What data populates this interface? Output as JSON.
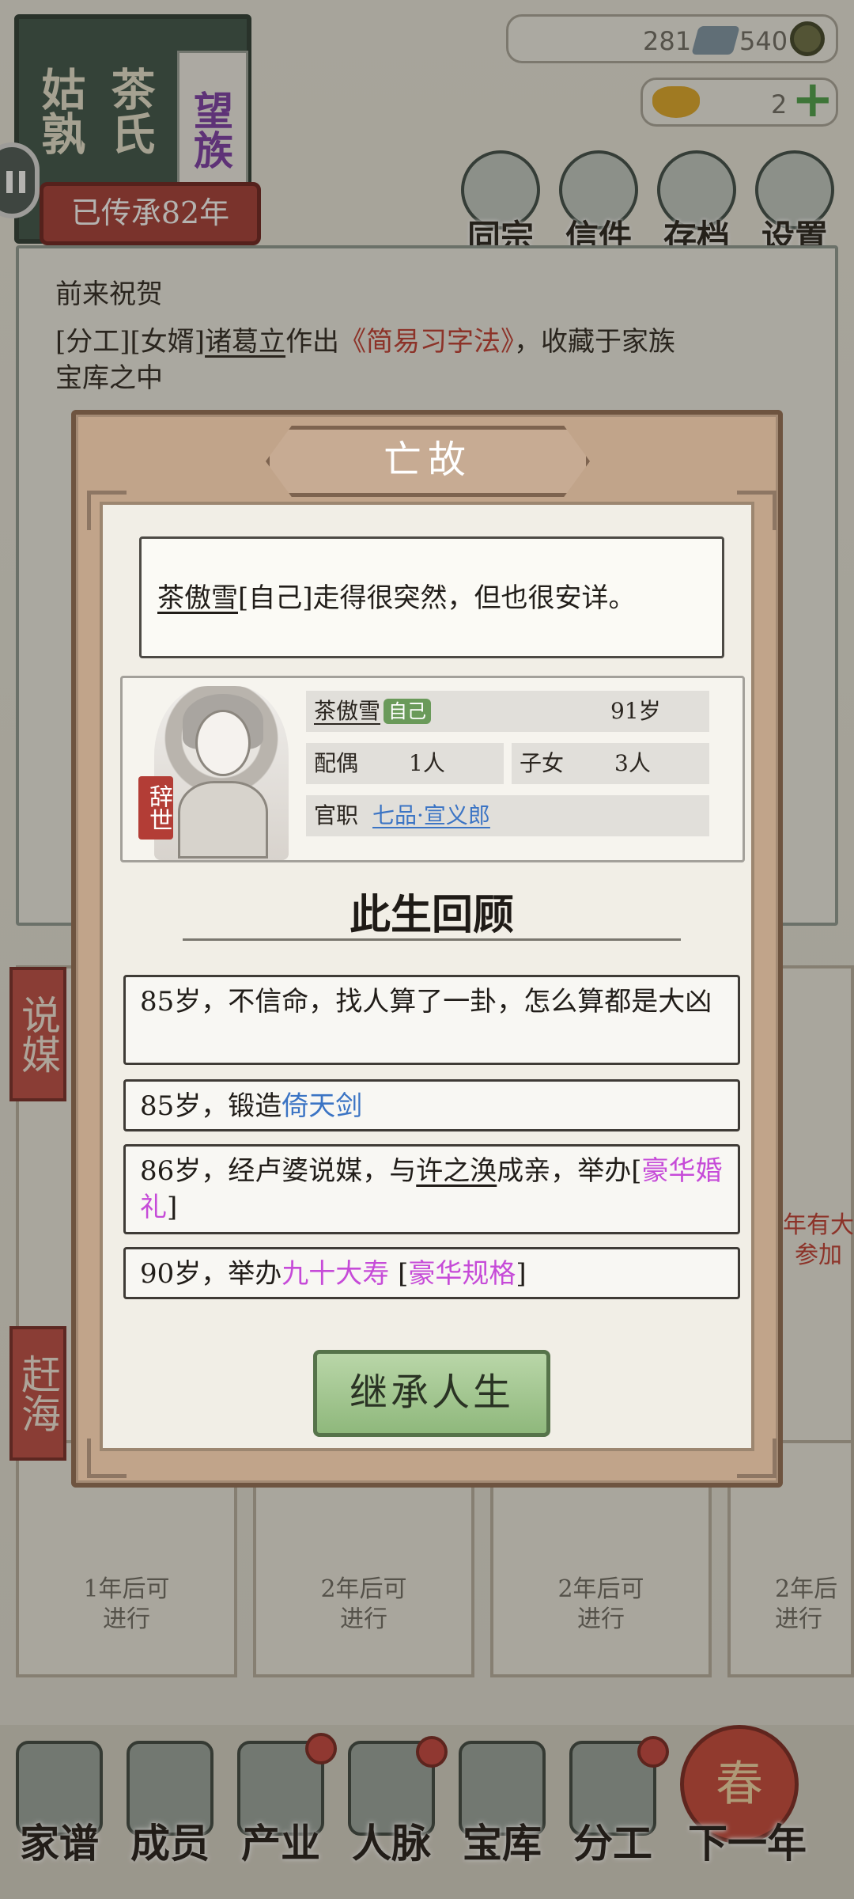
{
  "family": {
    "title_left": "姑孰",
    "title_right": "茶氏",
    "rank": "望族",
    "inheritance": "已传承82年"
  },
  "resources": {
    "silver": "281",
    "coins": "540",
    "gold": "2"
  },
  "top_buttons": [
    "同宗",
    "信件",
    "存档",
    "设置"
  ],
  "log": {
    "line1": "前来祝贺",
    "line2a": "[分工][女婿]",
    "line2_name": "诸葛立",
    "line2b": "作出",
    "line2_book": "《简易习字法》",
    "line2c": "，收藏于家族",
    "line3": "宝库之中"
  },
  "side_labels": [
    "说媒",
    "赶海"
  ],
  "cards": [
    {
      "line1": "1年后可",
      "line2": "进行"
    },
    {
      "line1": "2年后可",
      "line2": "进行"
    },
    {
      "line1": "2年后可",
      "line2": "进行"
    },
    {
      "line1": "2年后",
      "line2": "进行"
    }
  ],
  "card_peek": {
    "line1": "年有大",
    "line2": "参加"
  },
  "nav": [
    "家谱",
    "成员",
    "产业",
    "人脉",
    "宝库",
    "分工",
    "下一年"
  ],
  "lantern": "春",
  "modal": {
    "title": "亡故",
    "death_name": "茶傲雪",
    "death_msg": "[自己]走得很突然，但也很安详。",
    "profile": {
      "name": "茶傲雪",
      "self_tag": "自己",
      "age": "91岁",
      "spouse_label": "配偶",
      "spouse_value": "1人",
      "children_label": "子女",
      "children_value": "3人",
      "office_label": "官职",
      "office_value": "七品·宣义郎",
      "stamp": "辞世"
    },
    "review_title": "此生回顾",
    "events": {
      "e1": "85岁，不信命，找人算了一卦，怎么算都是大凶",
      "e2_prefix": "85岁，锻造",
      "e2_item": "倚天剑",
      "e3_prefix": "86岁，经卢婆说媒，与",
      "e3_name": "许之涣",
      "e3_mid": "成亲，举办[",
      "e3_ceremony": "豪华婚礼",
      "e3_end": "]",
      "e4_prefix": "90岁，举办",
      "e4_event": "九十大寿",
      "e4_mid": " [",
      "e4_scale": "豪华规格",
      "e4_end": "]"
    },
    "inherit_button": "继承人生"
  },
  "colors": {
    "accent_red": "#a63b35",
    "link_blue": "#3b74c4",
    "highlight_pink": "#c64bd8",
    "button_green": "#8fb87c",
    "self_tag_green": "#6a9a5a"
  }
}
